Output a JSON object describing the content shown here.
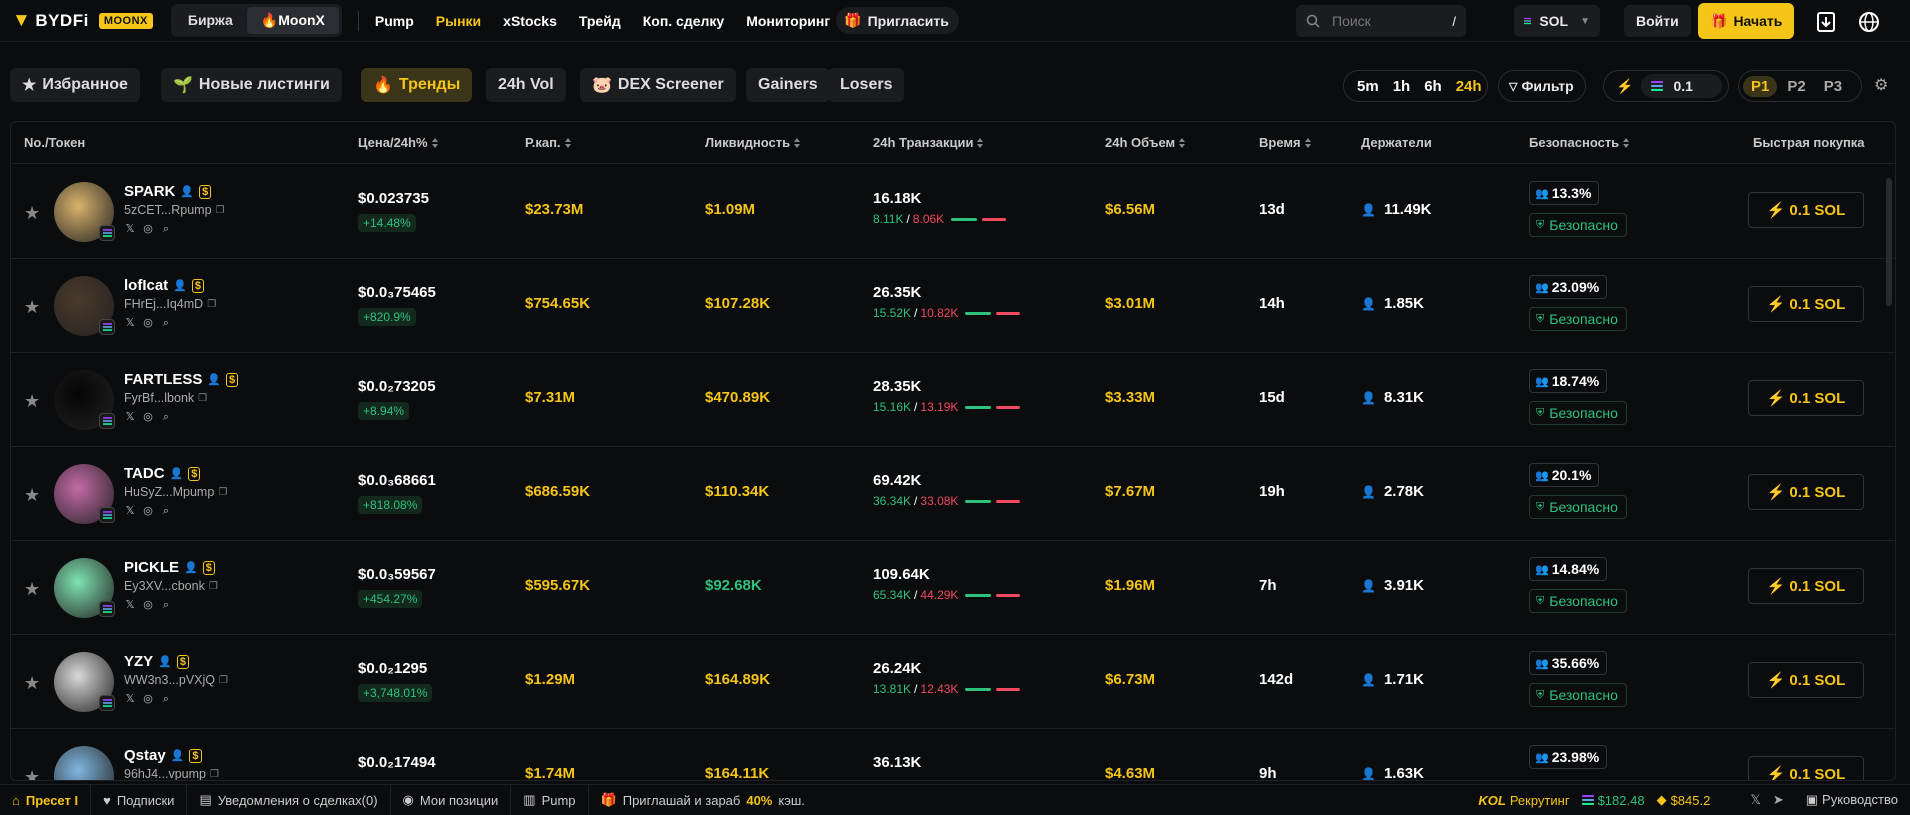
{
  "topbar": {
    "logo": "BYDFi",
    "moonx_badge": "MOONX",
    "seg": [
      "Биржа",
      "MoonX"
    ],
    "nav": [
      "Pump",
      "Рынки",
      "xStocks",
      "Трейд",
      "Коп. сделку",
      "Мониторинг"
    ],
    "invite": "Пригласить",
    "search_placeholder": "Поиск",
    "search_shortcut": "/",
    "chain": "SOL",
    "login": "Войти",
    "start": "Начать"
  },
  "tabs": [
    "Избранное",
    "Новые листинги",
    "Тренды",
    "24h Vol",
    "DEX Screener",
    "Gainers",
    "Losers"
  ],
  "timeframes": [
    "5m",
    "1h",
    "6h",
    "24h"
  ],
  "filter": "Фильтр",
  "quick_amount": "0.1",
  "presets": [
    "P1",
    "P2",
    "P3"
  ],
  "columns": [
    "No./Токен",
    "Цена/24h%",
    "Р.кап.",
    "Ликвидность",
    "24h Транзакции",
    "24h Объем",
    "Время",
    "Держатели",
    "Безопасность",
    "Быстрая покупка"
  ],
  "rows": [
    {
      "name": "SPARK",
      "addr": "5zCET...Rpump",
      "price": "$0.023735",
      "chg": "+14.48%",
      "mcap": "$23.73M",
      "liq": "$1.09M",
      "tx": "16.18K",
      "buys": "8.11K",
      "sells": "8.06K",
      "vol": "$6.56M",
      "time": "13d",
      "holders": "11.49K",
      "sec": "13.3%",
      "safe": "Безопасно",
      "buy": "0.1 SOL",
      "color": "#d9b36b"
    },
    {
      "name": "lofIcat",
      "addr": "FHrEj...Iq4mD",
      "price": "$0.0₃75465",
      "chg": "+820.9%",
      "mcap": "$754.65K",
      "liq": "$107.28K",
      "tx": "26.35K",
      "buys": "15.52K",
      "sells": "10.82K",
      "vol": "$3.01M",
      "time": "14h",
      "holders": "1.85K",
      "sec": "23.09%",
      "safe": "Безопасно",
      "buy": "0.1 SOL",
      "color": "#4b3a2a"
    },
    {
      "name": "FARTLESS",
      "addr": "FyrBf...lbonk",
      "price": "$0.0₂73205",
      "chg": "+8.94%",
      "mcap": "$7.31M",
      "liq": "$470.89K",
      "tx": "28.35K",
      "buys": "15.16K",
      "sells": "13.19K",
      "vol": "$3.33M",
      "time": "15d",
      "holders": "8.31K",
      "sec": "18.74%",
      "safe": "Безопасно",
      "buy": "0.1 SOL",
      "color": "#050505"
    },
    {
      "name": "TADC",
      "addr": "HuSyZ...Mpump",
      "price": "$0.0₃68661",
      "chg": "+818.08%",
      "mcap": "$686.59K",
      "liq": "$110.34K",
      "tx": "69.42K",
      "buys": "36.34K",
      "sells": "33.08K",
      "vol": "$7.67M",
      "time": "19h",
      "holders": "2.78K",
      "sec": "20.1%",
      "safe": "Безопасно",
      "buy": "0.1 SOL",
      "color": "#c46aa8"
    },
    {
      "name": "PICKLE",
      "addr": "Ey3XV...cbonk",
      "price": "$0.0₃59567",
      "chg": "+454.27%",
      "mcap": "$595.67K",
      "liq": "$92.68K",
      "tx": "109.64K",
      "buys": "65.34K",
      "sells": "44.29K",
      "vol": "$1.96M",
      "time": "7h",
      "holders": "3.91K",
      "sec": "14.84%",
      "safe": "Безопасно",
      "buy": "0.1 SOL",
      "color": "#7fe3b0"
    },
    {
      "name": "YZY",
      "addr": "WW3n3...pVXjQ",
      "price": "$0.0₂1295",
      "chg": "+3,748.01%",
      "mcap": "$1.29M",
      "liq": "$164.89K",
      "tx": "26.24K",
      "buys": "13.81K",
      "sells": "12.43K",
      "vol": "$6.73M",
      "time": "142d",
      "holders": "1.71K",
      "sec": "35.66%",
      "safe": "Безопасно",
      "buy": "0.1 SOL",
      "color": "#d9d9d9"
    },
    {
      "name": "Qstay",
      "addr": "96hJ4...vpump",
      "price": "$0.0₂17494",
      "chg": "",
      "mcap": "$1.74M",
      "liq": "$164.11K",
      "tx": "36.13K",
      "buys": "",
      "sells": "",
      "vol": "$4.63M",
      "time": "9h",
      "holders": "1.63K",
      "sec": "23.98%",
      "safe": "",
      "buy": "0.1 SOL",
      "color": "#7fb6e0"
    }
  ],
  "footer": {
    "preset": "Пресет I",
    "subscriptions": "Подписки",
    "notifications": "Уведомления о сделках(0)",
    "positions": "Мои позиции",
    "pump": "Pump",
    "promo": "Приглашай и зараб",
    "promo_pct": "40%",
    "promo_tail": "кэш.",
    "kol": "KOL",
    "recruiting": "Рекрутинг",
    "sol_price": "$182.48",
    "bnb_price": "$845.2",
    "guide": "Руководство"
  },
  "colors": {
    "accent": "#f5c518",
    "green": "#2ec27e",
    "red": "#f04a5f"
  }
}
